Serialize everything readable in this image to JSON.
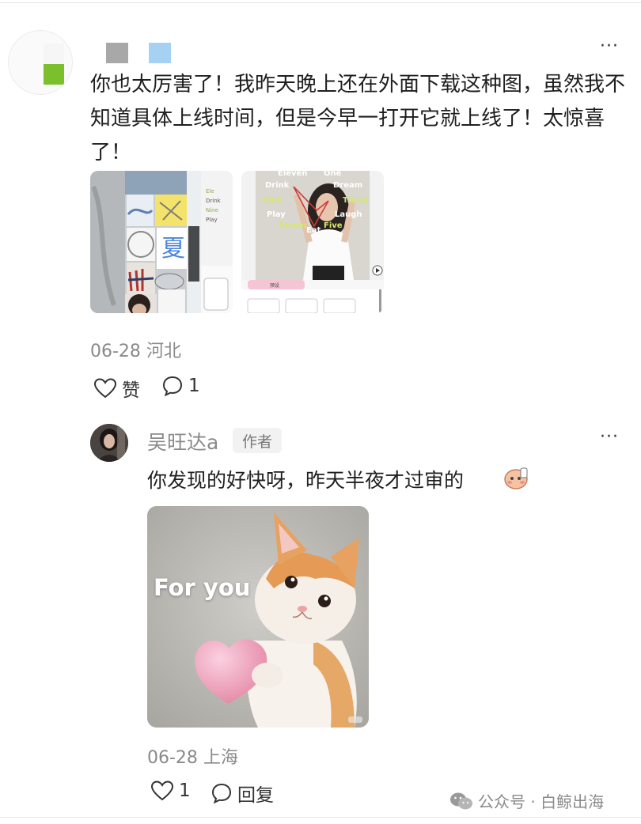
{
  "comment": {
    "text": "你也太厉害了！我昨天晚上还在外面下载这种图，虽然我不知道具体上线时间，但是今早一打开它就上线了！太惊喜了！",
    "date": "06-28",
    "location": "河北",
    "like_label": "赞",
    "reply_count": "1",
    "more_label": "···",
    "thumb2_words": [
      "Eleven",
      "One",
      "Drink",
      "Dream",
      "Nine",
      "Three",
      "Play",
      "Laugh",
      "Seven",
      "Eat",
      "Five"
    ],
    "thumb2_tab": "预设"
  },
  "reply": {
    "author": "吴旺达a",
    "author_tag": "作者",
    "text": "你发现的好快呀，昨天半夜才过审的",
    "image_caption": "For you",
    "date": "06-28",
    "location": "上海",
    "like_count": "1",
    "reply_label": "回复",
    "more_label": "···"
  },
  "watermark": "公众号 · 白鲸出海",
  "colors": {
    "avatar_green": "#7cbf2c",
    "name_block_gray": "#a8a8a8",
    "name_block_blue": "#a7d1f2",
    "meta_gray": "#8a8a8a"
  }
}
